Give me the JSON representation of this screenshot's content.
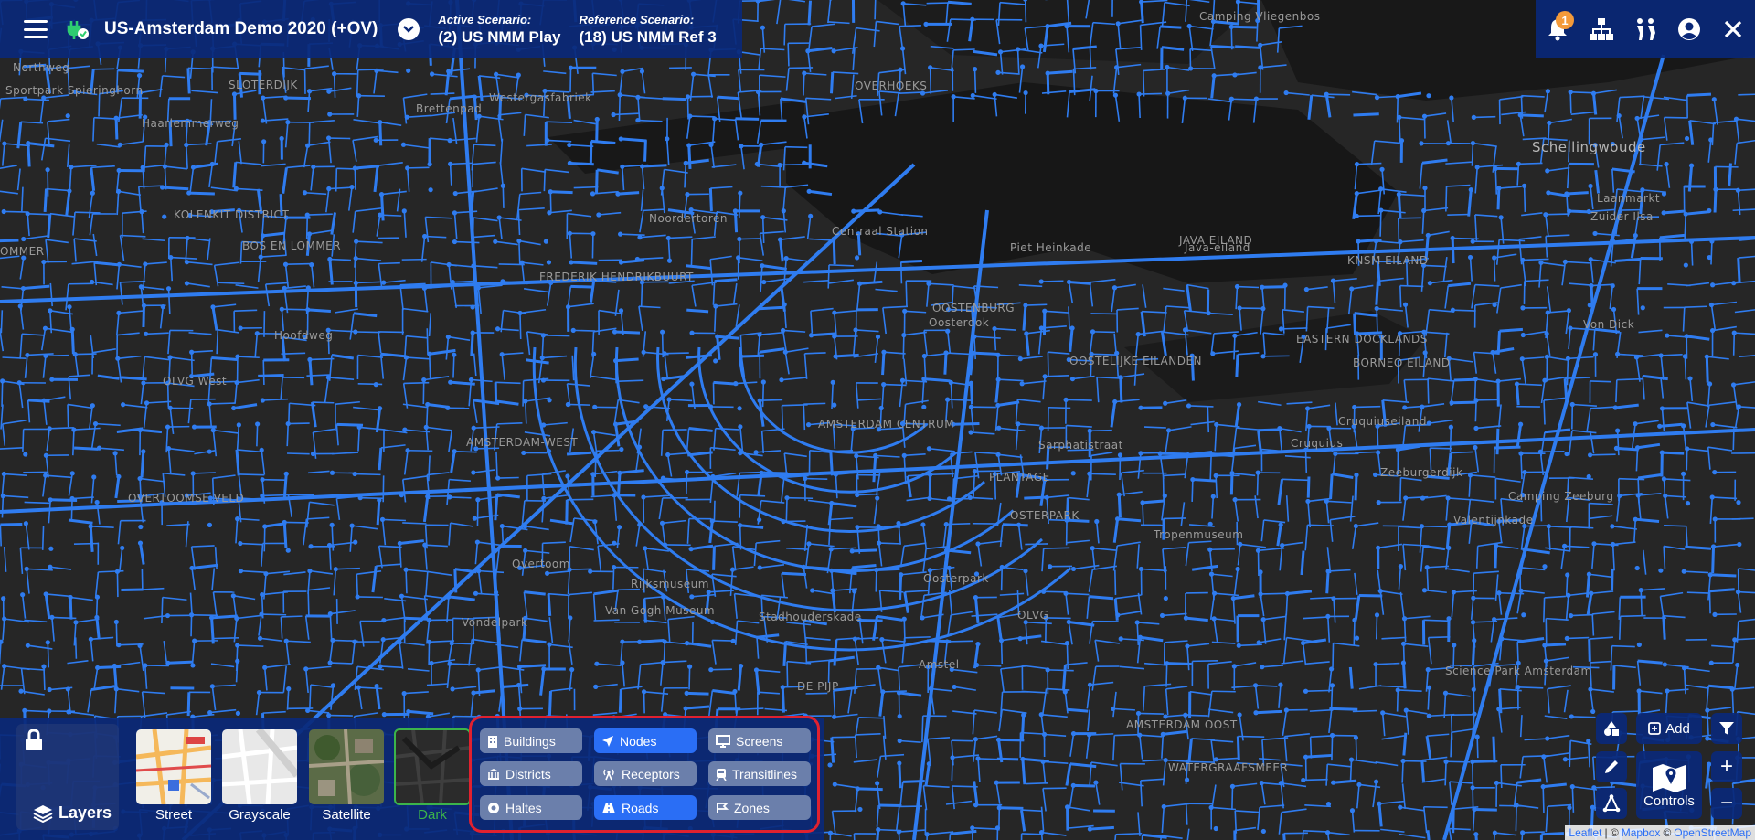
{
  "header": {
    "title": "US-Amsterdam Demo 2020 (+OV)",
    "active_label": "Active Scenario:",
    "active_value": "(2) US NMM Play",
    "reference_label": "Reference Scenario:",
    "reference_value": "(18) US NMM Ref 3",
    "notification_count": "1"
  },
  "map": {
    "labels": [
      "Northweg",
      "Sportpark Spieringhorn",
      "SLOTERDIJK",
      "Haarlemmerweg",
      "Westergasfabriek",
      "Brettenpad",
      "KOLENKIT DISTRICT",
      "OMMER",
      "BOS EN LOMMER",
      "FREDERIK HENDRIKBUURT",
      "Noordertoren",
      "Centraal Station",
      "OOSTELIJKE EILANDEN",
      "OOSTENBURG",
      "Oosterdok",
      "Piet Heinkade",
      "JAVA EILAND",
      "KNSM EILAND",
      "EASTERN DOCKLANDS",
      "BORNEO EILAND",
      "Cruquiuseiland",
      "Schellingwoude",
      "Laanmarkt",
      "Von Dick",
      "Zuider Ilsa",
      "OLVG West",
      "AMSTERDAM-WEST",
      "AMSTERDAM CENTRUM",
      "PLANTAGE",
      "OSTERPARK",
      "Zeeburgerdijk",
      "Camping Zeeburg",
      "OVERTOOMSE VELD",
      "Rijksmuseum",
      "Van Gogh Museum",
      "Vondelpark",
      "Stadhouderskade",
      "DE PIJP",
      "OLVG",
      "AMSTERDAM OOST",
      "WATERGRAAFSMEER",
      "Science Park Amsterdam",
      "Camping Vliegenbos",
      "OVERHOEKS",
      "Java-eiland",
      "Cruquius",
      "Sarphatistraat",
      "Valentijnkade",
      "Oosterpark",
      "Tropenmuseum",
      "Amstel",
      "Hoofdweg",
      "Overtoom"
    ]
  },
  "layers": {
    "label": "Layers",
    "basemaps": [
      "Street",
      "Grayscale",
      "Satellite",
      "Dark"
    ],
    "buttons": [
      {
        "label": "Buildings",
        "active": false
      },
      {
        "label": "Nodes",
        "active": true
      },
      {
        "label": "Screens",
        "active": false
      },
      {
        "label": "Districts",
        "active": false
      },
      {
        "label": "Receptors",
        "active": false
      },
      {
        "label": "Transitlines",
        "active": false
      },
      {
        "label": "Haltes",
        "active": false
      },
      {
        "label": "Roads",
        "active": true
      },
      {
        "label": "Zones",
        "active": false
      }
    ]
  },
  "controls": {
    "add_label": "Add",
    "controls_label": "Controls",
    "zoom_in": "+",
    "zoom_out": "−"
  },
  "attribution": {
    "leaflet": "Leaflet",
    "sep1": "| ©",
    "mapbox": "Mapbox",
    "sep2": "©",
    "osm": "OpenStreetMap"
  },
  "colors": {
    "road_blue": "#2f7cf0",
    "panel": "#0a2878",
    "active_button": "#2a6ef5",
    "badge": "#f39a3a",
    "highlight": "#e0212f"
  }
}
